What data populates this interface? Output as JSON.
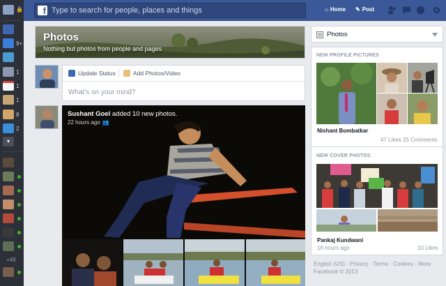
{
  "topbar": {
    "search_placeholder": "Type to search for people, places and things",
    "home_label": "Home",
    "post_label": "Post"
  },
  "rail": {
    "counts": [
      "9+",
      "1",
      "1",
      "1",
      "8",
      "2"
    ],
    "online_more": "+48"
  },
  "cover": {
    "title": "Photos",
    "subtitle": "Nothing but photos from people and pages"
  },
  "composer": {
    "update_status": "Update Status",
    "add_photos": "Add Photos/Video",
    "placeholder": "What's on your mind?"
  },
  "story": {
    "author": "Sushant Goel",
    "action": " added 10 new photos.",
    "time": "22 hours ago"
  },
  "sidebar": {
    "header_title": "Photos",
    "profile_section_title": "NEW PROFILE PICTURES",
    "profile_name": "Nishant Bombatkar",
    "profile_likes": "47 Likes",
    "profile_comments": "25 Comments",
    "cover_section_title": "NEW COVER PHOTOS",
    "cover_name": "Pankaj Kundwani",
    "cover_time": "16 hours ago",
    "cover_likes": "10 Likes"
  },
  "footer": {
    "line1": "English (US) · Privacy · Terms · Cookies · More ·",
    "line2": "Facebook © 2013"
  },
  "colors": {
    "brand_blue": "#3b5998",
    "page_bg": "#e9eaed",
    "rail_bg": "#2c3038",
    "online_green": "#42b72a"
  }
}
